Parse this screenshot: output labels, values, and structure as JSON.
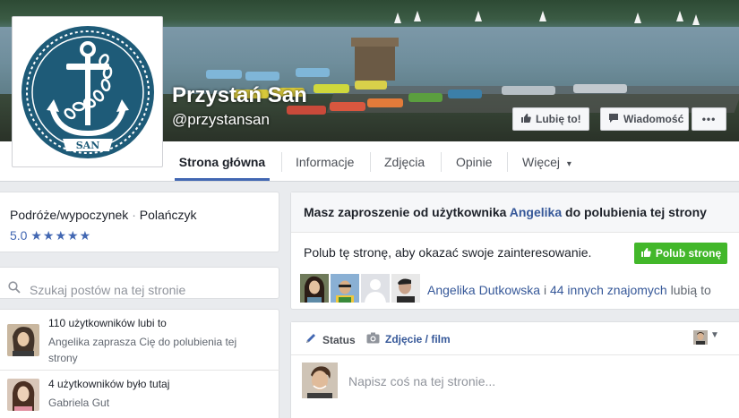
{
  "page": {
    "name": "Przystań San",
    "handle": "@przystansan",
    "logo_text": "SAN"
  },
  "cover_actions": {
    "like_label": "Lubię to!",
    "message_label": "Wiadomość",
    "more_label": "•••"
  },
  "nav": {
    "tabs": [
      {
        "label": "Strona główna",
        "active": true
      },
      {
        "label": "Informacje"
      },
      {
        "label": "Zdjęcia"
      },
      {
        "label": "Opinie"
      },
      {
        "label": "Więcej"
      }
    ],
    "more_caret": "▾"
  },
  "about": {
    "category": "Podróże/wypoczynek",
    "separator": "·",
    "location": "Polańczyk",
    "rating_value": "5.0",
    "rating_stars": 5
  },
  "search": {
    "placeholder": "Szukaj postów na tej stronie"
  },
  "stats": [
    {
      "title": "110 użytkowników lubi to",
      "sub": "Angelika zaprasza Cię do polubienia tej strony"
    },
    {
      "title": "4 użytkowników było tutaj",
      "sub": "Gabriela Gut"
    }
  ],
  "invite": {
    "title_prefix": "Masz zaproszenie od użytkownika",
    "inviter": "Angelika",
    "title_suffix": "do polubienia tej strony",
    "body": "Polub tę stronę, aby okazać swoje zainteresowanie.",
    "like_button": "Polub stronę",
    "friends_name": "Angelika Dutkowska",
    "friends_and": "i",
    "friends_others": "44 innych znajomych",
    "friends_suffix": "lubią to"
  },
  "composer": {
    "status_label": "Status",
    "photo_label": "Zdjęcie / film",
    "placeholder": "Napisz coś na tej stronie..."
  },
  "colors": {
    "facebook_blue": "#4267b2",
    "link_blue": "#365899",
    "like_green": "#42b72a",
    "logo_teal": "#1e5b78"
  }
}
